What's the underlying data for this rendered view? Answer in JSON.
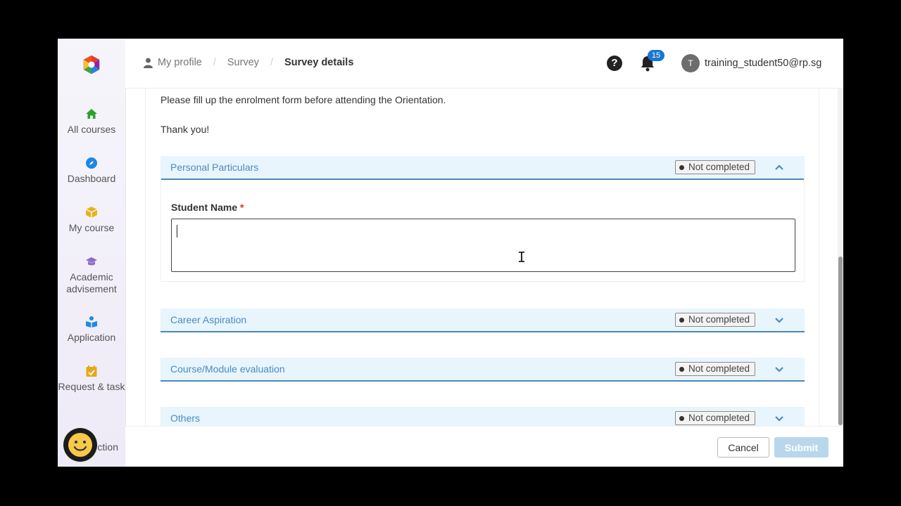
{
  "sidebar": {
    "items": [
      {
        "label": "All courses",
        "icon": "home-icon",
        "color": "#2ca02c"
      },
      {
        "label": "Dashboard",
        "icon": "compass-icon",
        "color": "#1e88e5"
      },
      {
        "label": "My course",
        "icon": "box-icon",
        "color": "#e6b422"
      },
      {
        "label": "Academic advisement",
        "icon": "graduation-cap-icon",
        "color": "#8e6cc9"
      },
      {
        "label": "Application",
        "icon": "reader-icon",
        "color": "#1e88e5"
      },
      {
        "label": "Request & task",
        "icon": "calendar-check-icon",
        "color": "#e6a817"
      },
      {
        "label": "ction",
        "icon": "partial-icon",
        "color": "#1e88e5"
      }
    ]
  },
  "topbar": {
    "breadcrumbs": [
      "My profile",
      "Survey",
      "Survey details"
    ],
    "notification_count": "15",
    "user_initial": "T",
    "user_email": "training_student50@rp.sg"
  },
  "intro": {
    "line1": "Please fill up the enrolment form before attending the Orientation.",
    "line2": "Thank you!"
  },
  "sections": [
    {
      "title": "Personal Particulars",
      "status": "Not completed",
      "expanded": true
    },
    {
      "title": "Career Aspiration",
      "status": "Not completed",
      "expanded": false
    },
    {
      "title": "Course/Module evaluation",
      "status": "Not completed",
      "expanded": false
    },
    {
      "title": "Others",
      "status": "Not completed",
      "expanded": false
    }
  ],
  "form": {
    "student_name_label": "Student Name",
    "required_mark": "*",
    "student_name_value": ""
  },
  "footer": {
    "cancel_label": "Cancel",
    "submit_label": "Submit"
  },
  "colors": {
    "accent": "#4b8bc0",
    "section_bg": "#e8f5fd",
    "submit_disabled": "#b9d7ec"
  }
}
